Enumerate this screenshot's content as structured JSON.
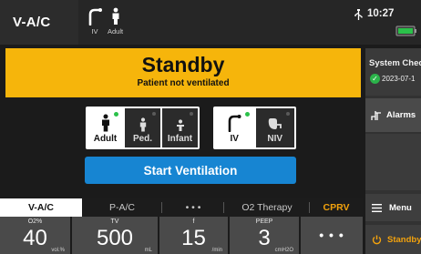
{
  "topbar": {
    "mode": "V-A/C",
    "interface_indicator": {
      "label": "IV",
      "icon": "iv-tube-icon"
    },
    "patient_indicator": {
      "label": "Adult",
      "icon": "adult-person-icon"
    },
    "time": "10:27",
    "usb_icon": "usb-icon",
    "battery_icon": "battery-icon",
    "battery_color": "#2bc14a"
  },
  "banner": {
    "title": "Standby",
    "subtitle": "Patient not ventilated",
    "color": "#f6b50b"
  },
  "patient_types": [
    {
      "label": "Adult",
      "icon": "adult-icon",
      "selected": true
    },
    {
      "label": "Ped.",
      "icon": "pediatric-icon",
      "selected": false
    },
    {
      "label": "Infant",
      "icon": "infant-icon",
      "selected": false
    }
  ],
  "interfaces": [
    {
      "label": "IV",
      "icon": "invasive-tube-icon",
      "selected": true
    },
    {
      "label": "NIV",
      "icon": "mask-icon",
      "selected": false
    }
  ],
  "start_button": {
    "label": "Start Ventilation",
    "color": "#1785d2"
  },
  "mode_tabs": [
    {
      "label": "V-A/C",
      "active": true
    },
    {
      "label": "P-A/C",
      "active": false
    },
    {
      "label": "• • •",
      "active": false
    },
    {
      "label": "O2 Therapy",
      "active": false
    },
    {
      "label": "CPRV",
      "active": false,
      "accent": "#f2a20d"
    }
  ],
  "parameters": [
    {
      "name": "O2%",
      "value": "40",
      "unit": "vol.%"
    },
    {
      "name": "TV",
      "value": "500",
      "unit": "mL"
    },
    {
      "name": "f",
      "value": "15",
      "unit": "/min"
    },
    {
      "name": "PEEP",
      "value": "3",
      "unit": "cmH2O"
    },
    {
      "name": "",
      "value": "• • •",
      "unit": ""
    }
  ],
  "side_panel": {
    "system_check": {
      "label": "System Chec",
      "date": "2023-07-1",
      "status_icon": "check-circle-icon",
      "status_color": "#2bb34a"
    },
    "alarms_label": "Alarms",
    "alarms_icon": "alarm-limits-icon",
    "menu_label": "Menu",
    "menu_icon": "hamburger-menu-icon",
    "standby_label": "Standby",
    "standby_icon": "power-icon",
    "standby_color": "#f2a20d"
  }
}
